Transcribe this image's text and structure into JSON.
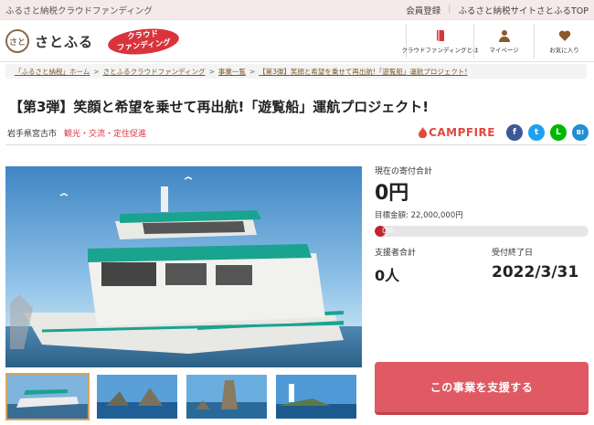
{
  "topbar": {
    "tagline": "ふるさと納税クラウドファンディング",
    "links": [
      "会員登録",
      "ふるさと納税サイトさとふるTOP"
    ]
  },
  "header": {
    "logo_text": "さとふる",
    "logo_mark": "さと",
    "badge_line1": "クラウド",
    "badge_line2": "ファンディング",
    "nav": [
      {
        "label": "クラウドファンディングとは",
        "icon": "book-icon"
      },
      {
        "label": "マイページ",
        "icon": "user-icon"
      },
      {
        "label": "お気に入り",
        "icon": "heart-icon"
      }
    ]
  },
  "breadcrumb": [
    "「ふるさと納税」ホーム",
    "さとふるクラウドファンディング",
    "事業一覧",
    "【第3弾】笑顔と希望を乗せて再出航!「遊覧船」運航プロジェクト!"
  ],
  "breadcrumb_sep": ">",
  "project": {
    "title": "【第3弾】笑顔と希望を乗せて再出航!「遊覧船」運航プロジェクト!",
    "location": "岩手県宮古市",
    "category": "観光・交流・定住促進"
  },
  "share": {
    "campfire": "CAMPFIRE",
    "icons": [
      {
        "name": "facebook-icon",
        "glyph": "f"
      },
      {
        "name": "twitter-icon",
        "glyph": "t"
      },
      {
        "name": "line-icon",
        "glyph": "L"
      },
      {
        "name": "hatena-icon",
        "glyph": "B!"
      }
    ]
  },
  "stats": {
    "current_label": "現在の寄付合計",
    "current_value": "0円",
    "goal_text": "目標金額: 22,000,000円",
    "progress_text": "0%",
    "progress_fraction": 0.0,
    "supporters_label": "支援者合計",
    "supporters_value": "0人",
    "deadline_label": "受付終了日",
    "deadline_value": "2022/3/31"
  },
  "cta_label": "この事業を支援する",
  "colors": {
    "accent": "#d9343c",
    "cta": "#df5a63",
    "topbar_bg": "#f6e9e9"
  }
}
